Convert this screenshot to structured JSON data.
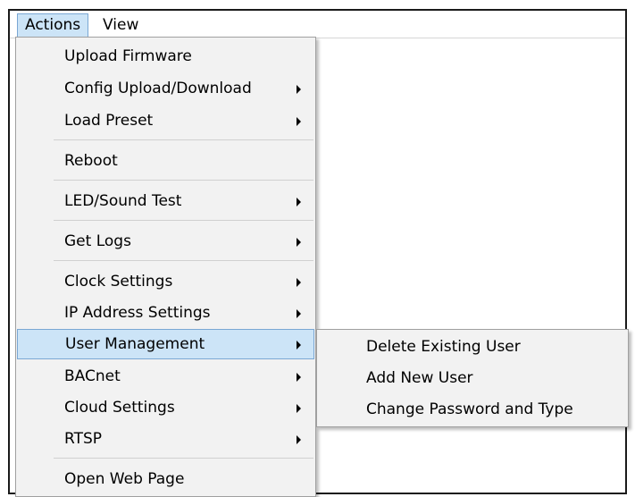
{
  "menubar": {
    "items": [
      {
        "label": "Actions"
      },
      {
        "label": "View"
      }
    ]
  },
  "actions_menu": {
    "items": [
      {
        "label": "Upload Firmware",
        "submenu": false
      },
      {
        "label": "Config Upload/Download",
        "submenu": true
      },
      {
        "label": "Load Preset",
        "submenu": true
      },
      {
        "label": "Reboot",
        "submenu": false
      },
      {
        "label": "LED/Sound Test",
        "submenu": true
      },
      {
        "label": "Get Logs",
        "submenu": true
      },
      {
        "label": "Clock Settings",
        "submenu": true
      },
      {
        "label": "IP Address Settings",
        "submenu": true
      },
      {
        "label": "User Management",
        "submenu": true,
        "selected": true
      },
      {
        "label": "BACnet",
        "submenu": true
      },
      {
        "label": "Cloud Settings",
        "submenu": true
      },
      {
        "label": "RTSP",
        "submenu": true
      },
      {
        "label": "Open Web Page",
        "submenu": false
      }
    ]
  },
  "user_management_submenu": {
    "items": [
      {
        "label": "Delete Existing User"
      },
      {
        "label": "Add New User"
      },
      {
        "label": "Change Password and Type"
      }
    ]
  },
  "colors": {
    "highlight": "#cce4f7",
    "highlight_border": "#7aa7d4",
    "menu_background": "#f2f2f2"
  }
}
